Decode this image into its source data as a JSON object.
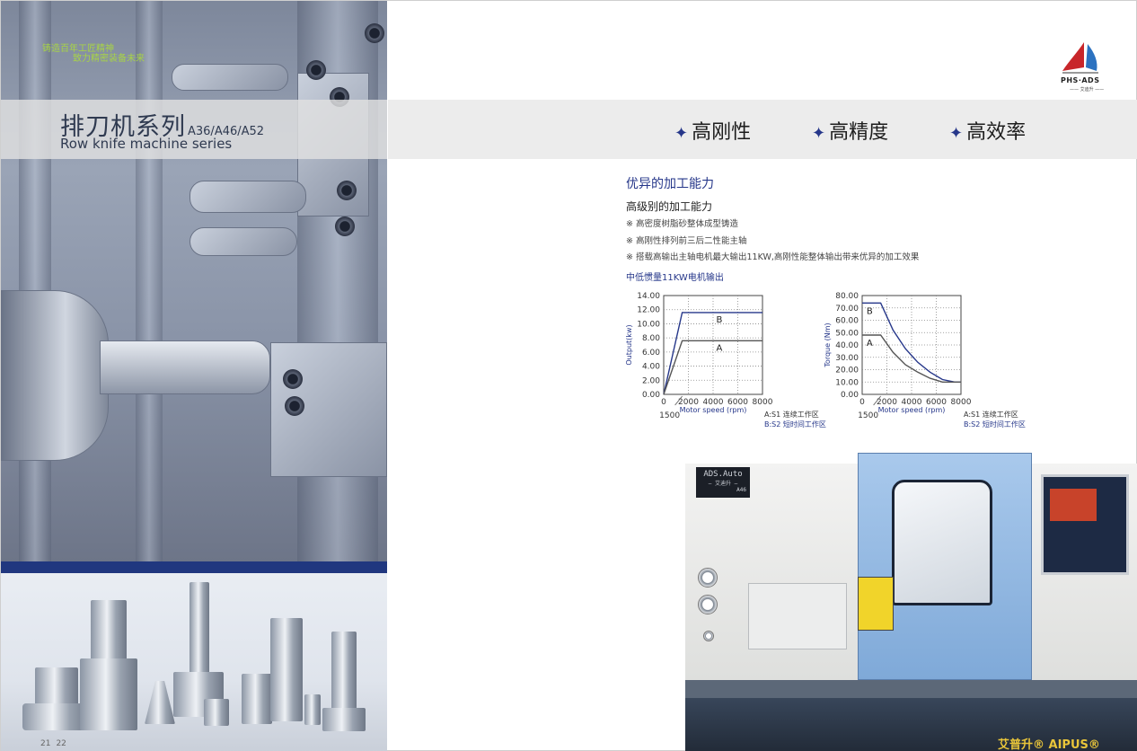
{
  "left": {
    "slogan": [
      "铸造百年工匠精神",
      "致力精密装备未来"
    ],
    "title_cn": "排刀机系列",
    "title_models": "A36/A46/A52",
    "title_en": "Row knife machine series",
    "page_numbers": [
      "21",
      "22"
    ]
  },
  "right": {
    "logo_brand": "PHS·ADS",
    "logo_sub": "—— 艾迪升 ——",
    "features": [
      "高刚性",
      "高精度",
      "高效率"
    ],
    "feature_star": "✦",
    "section_heading": "优异的加工能力",
    "sub_heading": "高级别的加工能力",
    "bullets": [
      "※ 高密度树脂砂整体成型铸造",
      "※ 高刚性排列前三后二性能主轴",
      "※ 搭载高输出主轴电机最大输出11KW,高刚性能整体输出带来优异的加工效果"
    ],
    "chart_section_title": "中低惯量11KW电机输出",
    "legend": [
      "A:S1 连续工作区",
      "B:S2 短时间工作区"
    ],
    "machine_nameplate_1": "ADS.Auto",
    "machine_nameplate_2": "— 艾迪升 —",
    "machine_nameplate_3": "A46",
    "machine_brand": "艾普升® AIPUS®"
  },
  "chart_data": [
    {
      "type": "line",
      "xlabel": "Motor speed (rpm)",
      "ylabel": "Output(kw)",
      "xlim": [
        0,
        8000
      ],
      "ylim": [
        0,
        14
      ],
      "x_ticks": [
        0,
        2000,
        4000,
        6000,
        8000
      ],
      "x_tick_labels": [
        "0",
        "2000",
        "4000",
        "6000",
        "8000"
      ],
      "y_ticks": [
        0,
        2,
        4,
        6,
        8,
        10,
        12,
        14
      ],
      "y_tick_labels": [
        "0.00",
        "2.00",
        "4.00",
        "6.00",
        "8.00",
        "10.00",
        "12.00",
        "14.00"
      ],
      "annotation": "1500",
      "grid": true,
      "series": [
        {
          "name": "B",
          "color": "#26378a",
          "x": [
            0,
            1500,
            8000
          ],
          "y": [
            0,
            11.6,
            11.6
          ]
        },
        {
          "name": "A",
          "color": "#555555",
          "x": [
            0,
            1500,
            8000
          ],
          "y": [
            0,
            7.6,
            7.6
          ]
        }
      ]
    },
    {
      "type": "line",
      "xlabel": "Motor speed (rpm)",
      "ylabel": "Torque (Nm)",
      "xlim": [
        0,
        8000
      ],
      "ylim": [
        0,
        80
      ],
      "x_ticks": [
        0,
        2000,
        4000,
        6000,
        8000
      ],
      "x_tick_labels": [
        "0",
        "2000",
        "4000",
        "6000",
        "8000"
      ],
      "y_ticks": [
        0,
        10,
        20,
        30,
        40,
        50,
        60,
        70,
        80
      ],
      "y_tick_labels": [
        "0.00",
        "10.00",
        "20.00",
        "30.00",
        "40.00",
        "50.00",
        "60.00",
        "70.00",
        "80.00"
      ],
      "annotation": "1500",
      "grid": true,
      "series": [
        {
          "name": "B",
          "color": "#26378a",
          "x": [
            0,
            1500,
            2500,
            3500,
            4500,
            5500,
            6500,
            7500,
            8000
          ],
          "y": [
            74,
            74,
            52,
            37,
            26,
            18,
            12,
            10,
            10
          ]
        },
        {
          "name": "A",
          "color": "#555555",
          "x": [
            0,
            1500,
            2500,
            3500,
            4500,
            5500,
            6500,
            7500,
            8000
          ],
          "y": [
            48,
            48,
            34,
            24,
            18,
            13,
            10,
            10,
            10
          ]
        }
      ]
    }
  ]
}
